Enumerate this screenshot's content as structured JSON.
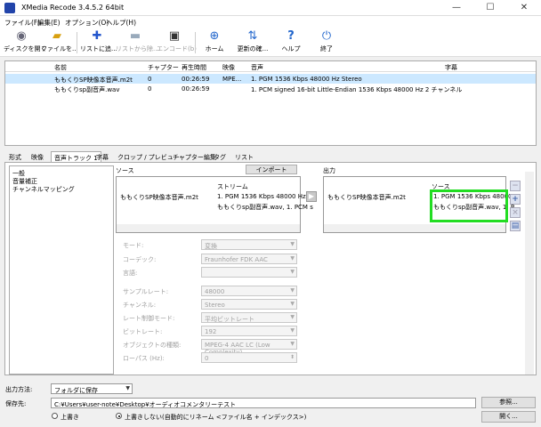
{
  "window": {
    "title": "XMedia Recode 3.4.5.2 64bit",
    "controls": [
      "—",
      "☐",
      "✕"
    ]
  },
  "menu": [
    "ファイル(F)",
    "編集(E)",
    "オプション(O)",
    "ヘルプ(H)"
  ],
  "toolbar": {
    "open_disc": "ディスクを開く",
    "open_file": "ファイルを...",
    "add_list": "リストに追...",
    "remove_list": "リストから除...",
    "encode": "エンコード(b)",
    "home": "ホーム",
    "update": "更新の確...",
    "help": "ヘルプ",
    "exit": "終了"
  },
  "filelist": {
    "headers": [
      "名前",
      "チャプター",
      "再生時間",
      "映像",
      "音声",
      "字幕"
    ],
    "rows": [
      {
        "name": "ももくりSP映像本音声.m2t",
        "chapter": "0",
        "duration": "00:26:59",
        "video": "MPE...",
        "audio": "1. PGM 1536 Kbps 48000 Hz Stereo",
        "sub": ""
      },
      {
        "name": "ももくりsp副音声.wav",
        "chapter": "0",
        "duration": "00:26:59",
        "video": "",
        "audio": "1. PCM signed 16-bit Little-Endian 1536 Kbps 48000 Hz 2 チャンネル",
        "sub": ""
      }
    ]
  },
  "tabs": [
    "形式",
    "映像",
    "音声トラック 1",
    "字幕",
    "クロップ / プレビュー",
    "チャプター編集",
    "タグ",
    "リスト"
  ],
  "nav": [
    "一般",
    "音量補正",
    "チャンネルマッピング"
  ],
  "source": {
    "label": "ソース",
    "import_label": "インポート",
    "stream_header": "ストリーム",
    "file": "ももくりSP映像本音声.m2t",
    "streams": [
      "1. PGM 1536 Kbps 48000 Hz St",
      "ももくりsp副音声.wav, 1. PCM s"
    ]
  },
  "output": {
    "label": "出力",
    "source_header": "ソース",
    "file": "ももくりSP映像本音声.m2t",
    "streams": [
      "1. PGM 1536 Kbps 48000 H",
      "ももくりsp副音声.wav, 1. P"
    ],
    "highlight_color": "#22dd22"
  },
  "settings": [
    {
      "label": "モード:",
      "value": "変換"
    },
    {
      "label": "コーデック:",
      "value": "Fraunhofer FDK AAC"
    },
    {
      "label": "言語:",
      "value": ""
    },
    {
      "label": "サンプルレート:",
      "value": "48000"
    },
    {
      "label": "チャンネル:",
      "value": "Stereo"
    },
    {
      "label": "レート制御モード:",
      "value": "平均ビットレート"
    },
    {
      "label": "ビットレート:",
      "value": "192"
    },
    {
      "label": "オブジェクトの種類:",
      "value": "MPEG-4 AAC LC (Low Complexity)"
    },
    {
      "label": "ローパス (Hz):",
      "value": "0"
    }
  ],
  "bottom": {
    "output_method_label": "出力方法:",
    "output_method": "フォルダに保存",
    "save_to_label": "保存先:",
    "save_path": "C:¥Users¥user-note¥Desktop¥オーディオコメンタリーテスト",
    "browse": "参照...",
    "open": "開く...",
    "overwrite": "上書き",
    "no_overwrite": "上書きしない(自動的にリネーム <ファイル名 + インデックス>)"
  }
}
